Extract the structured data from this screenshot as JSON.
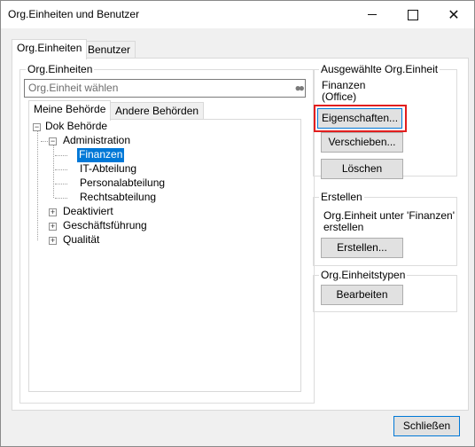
{
  "window": {
    "title": "Org.Einheiten und Benutzer"
  },
  "tabs": {
    "org": "Org.Einheiten",
    "users": "Benutzer"
  },
  "left": {
    "group_label": "Org.Einheiten",
    "search_placeholder": "Org.Einheit wählen",
    "subtabs": {
      "mine": "Meine Behörde",
      "other": "Andere Behörden"
    },
    "tree": {
      "root": "Dok Behörde",
      "admin": "Administration",
      "children": [
        "Finanzen",
        "IT-Abteilung",
        "Personalabteilung",
        "Rechtsabteilung"
      ],
      "others": [
        "Deaktiviert",
        "Geschäftsführung",
        "Qualität"
      ]
    }
  },
  "right": {
    "selected_group": "Ausgewählte Org.Einheit",
    "selected_name": "Finanzen",
    "selected_type": "(Office)",
    "btn_properties": "Eigenschaften...",
    "btn_move": "Verschieben...",
    "btn_delete": "Löschen",
    "create_group": "Erstellen",
    "create_text_1": "Org.Einheit unter 'Finanzen'",
    "create_text_2": "erstellen",
    "btn_create": "Erstellen...",
    "types_group": "Org.Einheitstypen",
    "btn_edit": "Bearbeiten"
  },
  "footer": {
    "close": "Schließen"
  }
}
